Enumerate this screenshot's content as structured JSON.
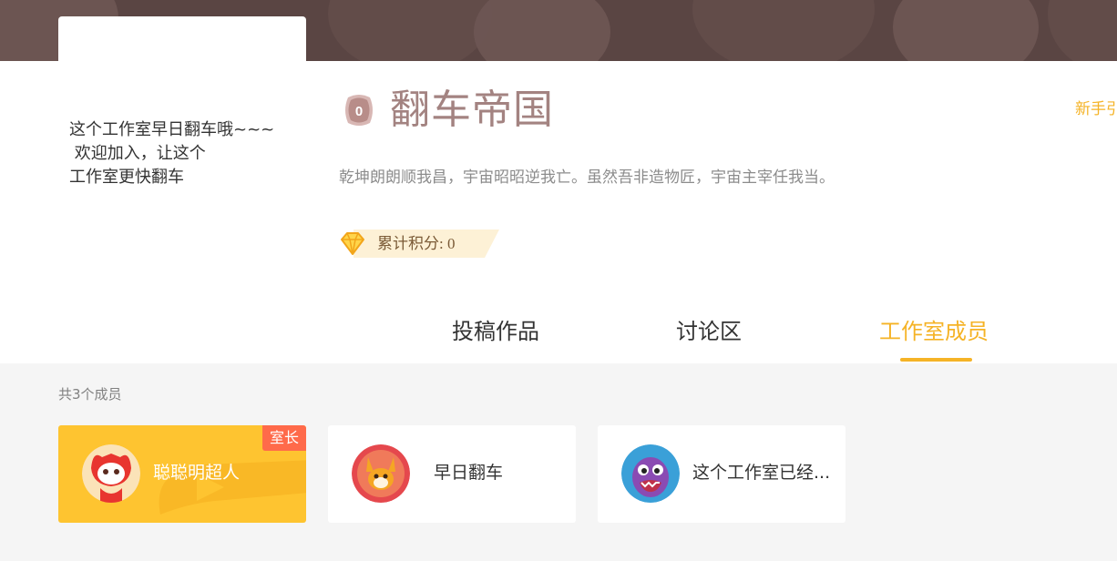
{
  "studio": {
    "name": "翻车帝国",
    "description_lines": [
      "这个工作室早日翻车哦~~~",
      " 欢迎加入，让这个",
      "工作室更快翻车"
    ],
    "motto": "乾坤朗朗顺我昌，宇宙昭昭逆我亡。虽然吾非造物匠，宇宙主宰任我当。",
    "score_text": "累计积分: 0",
    "level_badge": "0",
    "newbie_link": "新手引"
  },
  "tabs": [
    {
      "label": "投稿作品",
      "active": false
    },
    {
      "label": "讨论区",
      "active": false
    },
    {
      "label": "工作室成员",
      "active": true
    }
  ],
  "members": {
    "count_text": "共3个成员",
    "owner_tag": "室长",
    "list": [
      {
        "name": "聪聪明超人",
        "role": "owner",
        "avatar_icon": "red-fox-avatar"
      },
      {
        "name": "早日翻车",
        "role": "member",
        "avatar_icon": "orange-fox-avatar"
      },
      {
        "name": "这个工作室已经...",
        "role": "member",
        "avatar_icon": "purple-monster-avatar"
      }
    ]
  },
  "colors": {
    "accent": "#f5b326",
    "banner": "#5a4543",
    "owner_card": "#fec430",
    "owner_tag": "#ff6a4a",
    "studio_name": "#a38381"
  }
}
